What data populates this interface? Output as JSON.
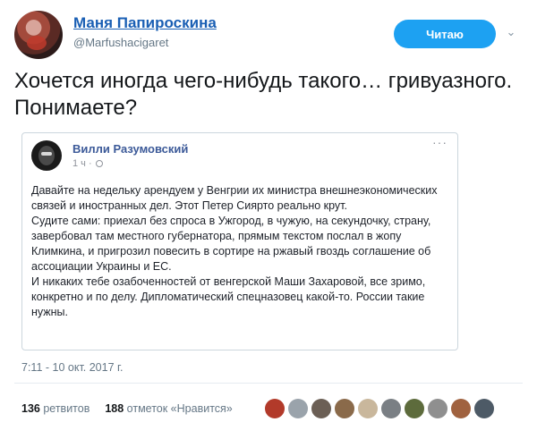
{
  "tweet": {
    "author_name": "Маня Папироскина",
    "author_handle": "@Marfushacigaret",
    "follow_label": "Читаю",
    "text": "Хочется иногда чего-нибудь такого… гривуазного. Понимаете?",
    "timestamp": "7:11 - 10 окт. 2017 г.",
    "retweets_count": "136",
    "retweets_label": "ретвитов",
    "likes_count": "188",
    "likes_label": "отметок «Нравится»"
  },
  "quote": {
    "author_name": "Вилли Разумовский",
    "time": "1 ч ·",
    "paragraphs": [
      "Давайте на недельку арендуем у Венгрии их министра внешнеэкономических связей и иностранных дел. Этот Петер Сиярто реально крут.",
      "Судите сами: приехал без спроса в Ужгород, в чужую, на секундочку, страну, завербовал там местного губернатора, прямым текстом послал в жопу Климкина, и пригрозил повесить в сортире на ржавый гвоздь соглашение об ассоциации Украины и ЕС.",
      "И никаких тебе озабоченностей от венгерской Маши Захаровой, все зримо, конкретно и по делу. Дипломатический спецназовец какой-то. России такие нужны."
    ]
  },
  "liker_colors": [
    "#b23a2a",
    "#9aa3ab",
    "#6b5f55",
    "#8a6a4a",
    "#c9b79c",
    "#7a7f84",
    "#5d6b3c",
    "#8f8f8f",
    "#a0623f",
    "#4d5a66"
  ],
  "colors": {
    "accent": "#1da1f2",
    "name_link": "#1a5fb4",
    "quote_name": "#3b5998"
  }
}
